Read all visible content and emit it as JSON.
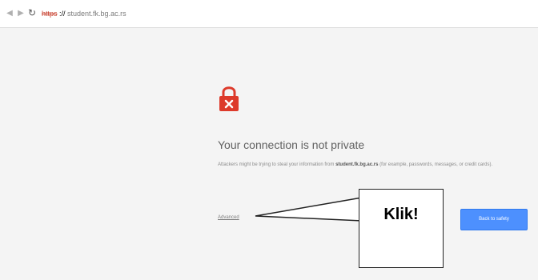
{
  "browser": {
    "url_scheme": "https",
    "url_host": "student.fk.bg.ac.rs",
    "back_icon": "arrow-left-icon",
    "forward_icon": "arrow-right-icon",
    "reload_icon": "reload-icon"
  },
  "interstitial": {
    "icon": "broken-lock-icon",
    "icon_color": "#dd3a2b",
    "title": "Your connection is not private",
    "body_prefix": "Attackers might be trying to steal your information from",
    "body_host": "student.fk.bg.ac.rs",
    "body_suffix": "(for example, passwords, messages, or credit cards).",
    "advanced_link": "Advanced",
    "back_button": "Back to safety",
    "accent_color": "#4d90fe"
  },
  "annotation": {
    "callout_text": "Klik!"
  }
}
